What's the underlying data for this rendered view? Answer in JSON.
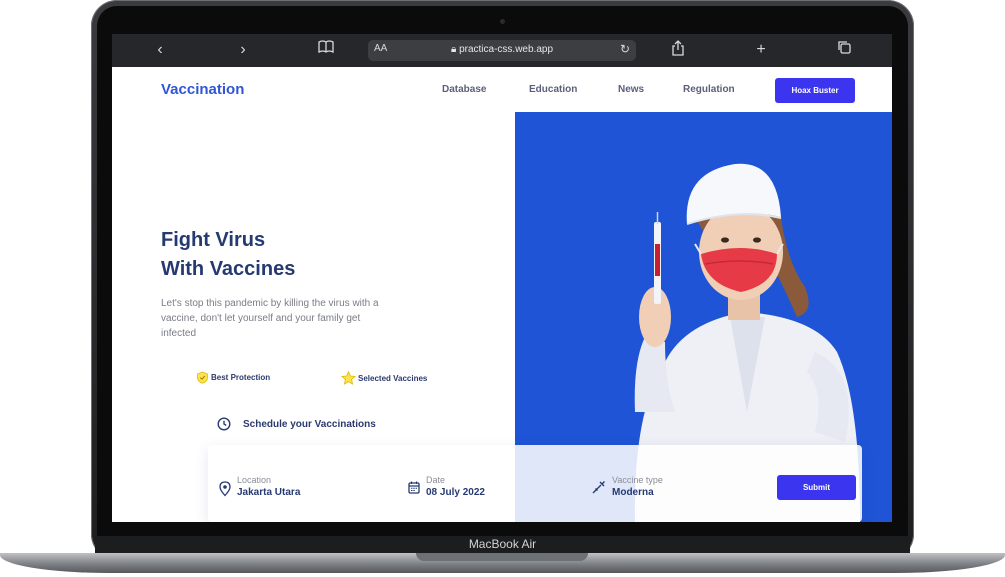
{
  "browser": {
    "text_size_label": "AA",
    "url": "practica-css.web.app"
  },
  "nav": {
    "brand": "Vaccination",
    "links": [
      "Database",
      "Education",
      "News",
      "Regulation"
    ],
    "cta": "Hoax Buster"
  },
  "hero": {
    "title_line1": "Fight Virus",
    "title_line2": "With Vaccines",
    "description": "Let's stop this pandemic by killing the virus with a vaccine, don't let yourself and your family get infected",
    "features": [
      "Best Protection",
      "Selected Vaccines"
    ],
    "schedule_label": "Schedule your Vaccinations"
  },
  "booking": {
    "location_label": "Location",
    "location_value": "Jakarta Utara",
    "date_label": "Date",
    "date_value": "08 July 2022",
    "vaccine_label": "Vaccine type",
    "vaccine_value": "Moderna",
    "submit_label": "Submit"
  },
  "device": {
    "label": "MacBook Air"
  },
  "colors": {
    "accent": "#3b35ef",
    "brand_text": "#2f56d6",
    "heading": "#263a72",
    "photo_background": "#1f54d6"
  }
}
